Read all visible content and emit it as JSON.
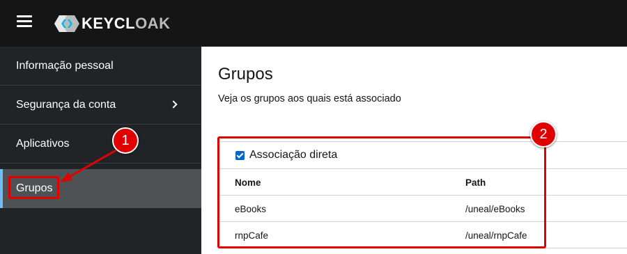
{
  "header": {
    "menu_icon": "hamburger-icon",
    "logo_icon": "keycloak-logo-icon",
    "logo_text_bold": "KEYCL",
    "logo_text_muted": "OAK"
  },
  "sidebar": {
    "items": [
      {
        "label": "Informação pessoal",
        "active": false,
        "has_chevron": false
      },
      {
        "label": "Segurança da conta",
        "active": false,
        "has_chevron": true
      },
      {
        "label": "Aplicativos",
        "active": false,
        "has_chevron": false
      },
      {
        "label": "Grupos",
        "active": true,
        "has_chevron": false
      }
    ]
  },
  "main": {
    "title": "Grupos",
    "description": "Veja os grupos aos quais está associado",
    "direct_membership": {
      "label": "Associação direta",
      "checked": true
    },
    "table": {
      "columns": [
        "Nome",
        "Path"
      ],
      "rows": [
        [
          "eBooks",
          "/uneal/eBooks"
        ],
        [
          "rnpCafe",
          "/uneal/rnpCafe"
        ]
      ]
    }
  },
  "annotations": {
    "callout_1": "1",
    "callout_2": "2",
    "highlight_color": "#e00000"
  },
  "colors": {
    "masthead": "#151515",
    "sidebar": "#212427",
    "sidebar_active": "#4f5255",
    "accent": "#73bcf7",
    "checkbox": "#0066cc"
  }
}
